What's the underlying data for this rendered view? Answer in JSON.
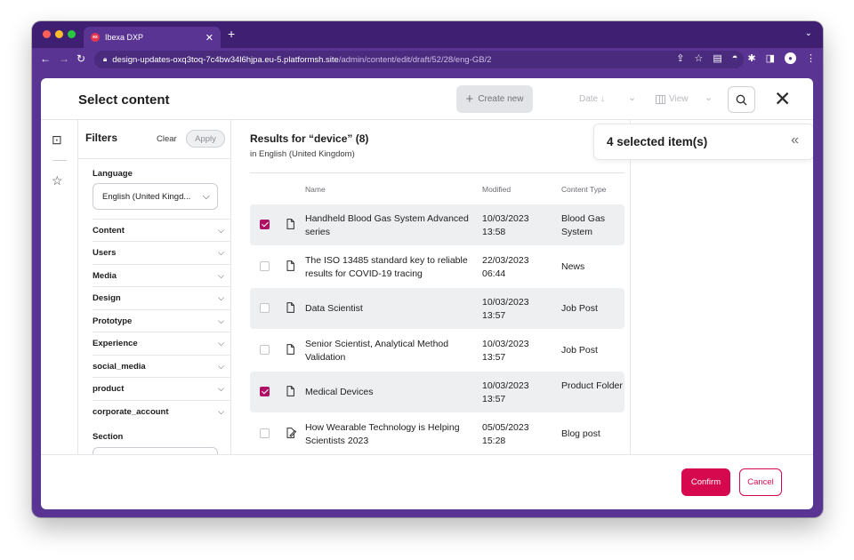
{
  "browser": {
    "tab_title": "Ibexa DXP",
    "favicon_text": "ex",
    "url_host": "design-updates-oxq3toq-7c4bw34l6hjpa.eu-5.platformsh.site",
    "url_path": "/admin/content/edit/draft/52/28/eng-GB/2"
  },
  "header": {
    "title": "Select content",
    "create_label": "Create new",
    "sort_label": "Date ↓",
    "view_label": "View"
  },
  "filters": {
    "title": "Filters",
    "clear_label": "Clear",
    "apply_label": "Apply",
    "language_label": "Language",
    "language_value": "English (United Kingd...",
    "groups": [
      "Content",
      "Users",
      "Media",
      "Design",
      "Prototype",
      "Experience",
      "social_media",
      "product",
      "corporate_account"
    ],
    "section_label": "Section"
  },
  "results": {
    "title": "Results for “device” (8)",
    "subtitle": "in English (United Kingdom)",
    "columns": {
      "name": "Name",
      "modified": "Modified",
      "type": "Content Type"
    },
    "rows": [
      {
        "name": "Handheld Blood Gas System Advanced series",
        "modified": "10/03/2023 13:58",
        "type": "Blood Gas System",
        "checked": true,
        "icon": "file-icon"
      },
      {
        "name": "The ISO 13485 standard key to reliable results for COVID-19 tracing",
        "modified": "22/03/2023 06:44",
        "type": "News",
        "checked": false,
        "icon": "file-icon"
      },
      {
        "name": "Data Scientist",
        "modified": "10/03/2023 13:57",
        "type": "Job Post",
        "checked": false,
        "icon": "file-icon"
      },
      {
        "name": "Senior Scientist, Analytical Method Validation",
        "modified": "10/03/2023 13:57",
        "type": "Job Post",
        "checked": false,
        "icon": "file-icon"
      },
      {
        "name": "Medical Devices",
        "modified": "10/03/2023 13:57",
        "type": "Product Folder",
        "checked": true,
        "icon": "file-icon"
      },
      {
        "name": "How Wearable Technology is Helping Scientists 2023",
        "modified": "05/05/2023 15:28",
        "type": "Blog post",
        "checked": false,
        "icon": "blog-post-icon"
      }
    ]
  },
  "selected": {
    "count_label": "4 selected item(s)"
  },
  "footer": {
    "confirm_label": "Confirm",
    "cancel_label": "Cancel"
  },
  "colors": {
    "accent": "#d6094f",
    "checkbox": "#ae1164",
    "browser_frame": "#5a3493"
  }
}
